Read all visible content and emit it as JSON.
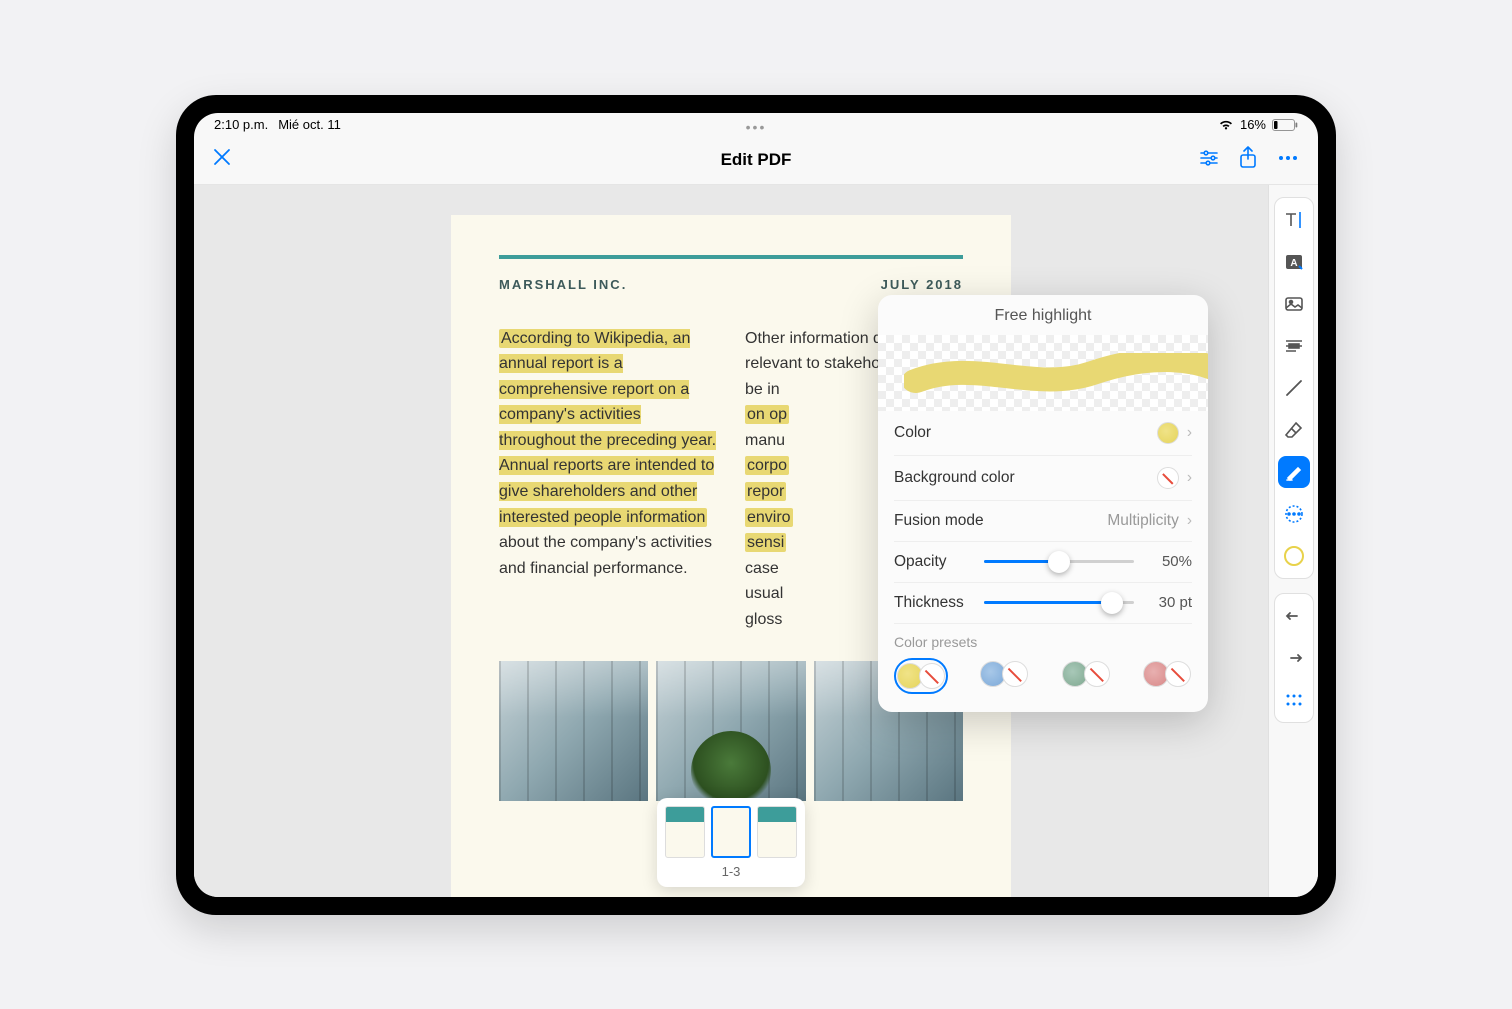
{
  "status": {
    "time": "2:10 p.m.",
    "date": "Mié oct. 11",
    "battery": "16%"
  },
  "nav": {
    "title": "Edit PDF"
  },
  "document": {
    "company": "MARSHALL INC.",
    "date": "JULY 2018",
    "col1_highlighted": "According to Wikipedia, an annual report is a comprehensive report on a company's activities throughout the preceding year. Annual reports are intended to give shareholders and other interested people information",
    "col1_rest": " about the company's activities and financial performance.",
    "col2_a": "Other information deemed relevant to stakeholders may be in",
    "col2_b": "on op",
    "col2_c": "manu",
    "col2_d": "corpo",
    "col2_e": "repor",
    "col2_f": "enviro",
    "col2_g": "sensi",
    "col2_h": "case ",
    "col2_i": "usual",
    "col2_j": "gloss"
  },
  "thumbs": {
    "label": "1-3"
  },
  "popover": {
    "title": "Free highlight",
    "color_label": "Color",
    "bgcolor_label": "Background color",
    "fusion_label": "Fusion mode",
    "fusion_value": "Multiplicity",
    "opacity_label": "Opacity",
    "opacity_value": "50%",
    "opacity_pct": 50,
    "thickness_label": "Thickness",
    "thickness_value": "30 pt",
    "thickness_pct": 85,
    "presets_label": "Color presets"
  }
}
